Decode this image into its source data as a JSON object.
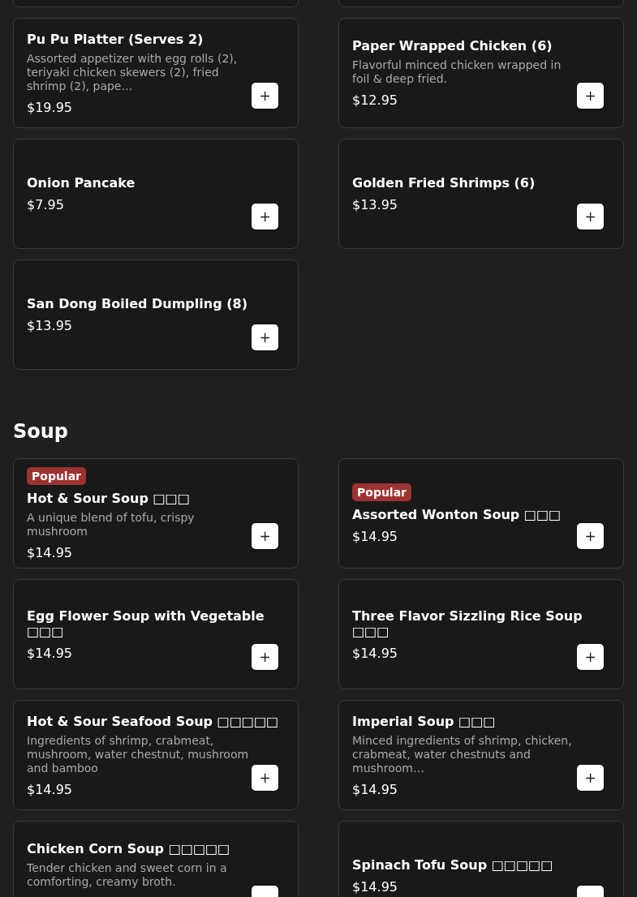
{
  "sections": [
    {
      "items": [
        {
          "name": "Pu Pu Platter (Serves 2)",
          "description": "Assorted appetizer with egg rolls (2), teriyaki chicken skewers (2), fried shrimp (2), pape…",
          "price": "$19.95",
          "button": "+"
        },
        {
          "name": "Paper Wrapped Chicken (6)",
          "description": "Flavorful minced chicken wrapped in foil & deep fried.",
          "price": "$12.95",
          "button": "+"
        },
        {
          "name": "Onion Pancake",
          "price": "$7.95",
          "button": "+"
        },
        {
          "name": "Golden Fried Shrimps (6)",
          "price": "$13.95",
          "button": "+"
        },
        {
          "name": "San Dong Boiled Dumpling (8)",
          "price": "$13.95",
          "button": "+"
        }
      ]
    },
    {
      "title": "Soup",
      "items": [
        {
          "badge": "Popular",
          "name": "Hot & Sour Soup □□□",
          "description": "A unique blend of tofu, crispy mushroom",
          "price": "$14.95",
          "button": "+"
        },
        {
          "badge": "Popular",
          "name": "Assorted Wonton Soup □□□",
          "price": "$14.95",
          "button": "+"
        },
        {
          "name": "Egg Flower Soup with Vegetable □□□",
          "price": "$14.95",
          "button": "+"
        },
        {
          "name": "Three Flavor Sizzling Rice Soup □□□",
          "price": "$14.95",
          "button": "+"
        },
        {
          "name": "Hot & Sour Seafood Soup □□□□□",
          "description": "Ingredients of shrimp, crabmeat, mushroom, water chestnut, mushroom and bamboo",
          "price": "$14.95",
          "button": "+"
        },
        {
          "name": "Imperial Soup □□□",
          "description": "Minced ingredients of shrimp, chicken, crabmeat, water chestnuts and mushroom…",
          "price": "$14.95",
          "button": "+"
        },
        {
          "name": "Chicken Corn Soup □□□□□",
          "description": "Tender chicken and sweet corn in a comforting, creamy broth."
        },
        {
          "name": "Spinach Tofu Soup □□□□□",
          "price": "$14.95"
        }
      ]
    }
  ]
}
